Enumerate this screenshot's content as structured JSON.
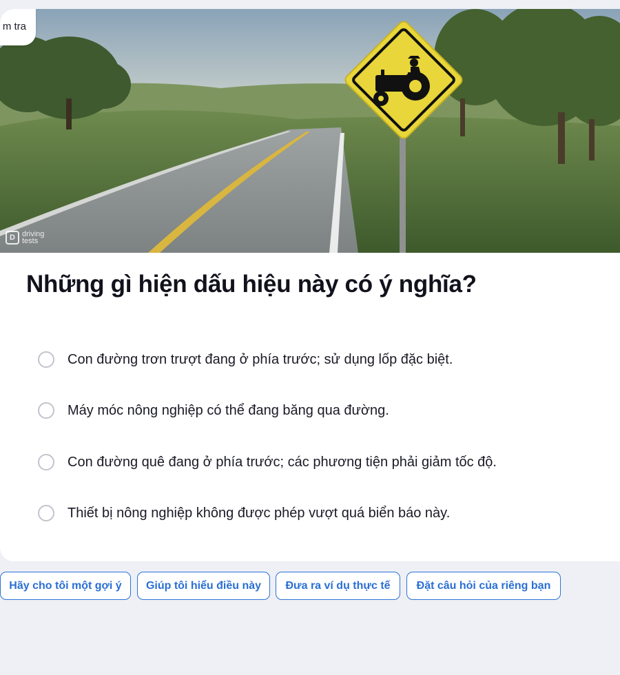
{
  "badge": {
    "label": "m tra"
  },
  "hero": {
    "watermark_line1": "driving",
    "watermark_line2": "tests",
    "image": "tractor-crossing-road-sign"
  },
  "question": {
    "text": "Những gì hiện dấu hiệu này có ý nghĩa?"
  },
  "options": [
    {
      "label": "Con đường trơn trượt đang ở phía trước; sử dụng lốp đặc biệt."
    },
    {
      "label": "Máy móc nông nghiệp có thể đang băng qua đường."
    },
    {
      "label": "Con đường quê đang ở phía trước; các phương tiện phải giảm tốc độ."
    },
    {
      "label": "Thiết bị nông nghiệp không được phép vượt quá biển báo này."
    }
  ],
  "chips": [
    {
      "label": "Hãy cho tôi một gợi ý"
    },
    {
      "label": "Giúp tôi hiểu điều này"
    },
    {
      "label": "Đưa ra ví dụ thực tế"
    },
    {
      "label": "Đặt câu hỏi của riêng bạn"
    }
  ],
  "colors": {
    "accent": "#2a72d8",
    "background": "#eff0f5",
    "sign_yellow": "#e8d63a"
  }
}
